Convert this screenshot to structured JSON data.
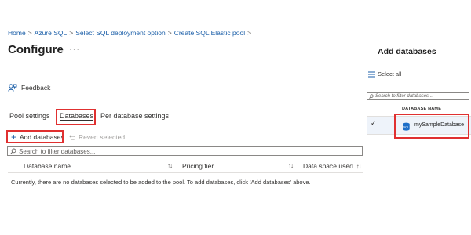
{
  "breadcrumb": {
    "items": [
      "Home",
      "Azure SQL",
      "Select SQL deployment option",
      "Create SQL Elastic pool"
    ],
    "separator": ">"
  },
  "page": {
    "title": "Configure",
    "more": "···"
  },
  "feedback": {
    "label": "Feedback",
    "icon": "feedback-icon"
  },
  "tabs": [
    {
      "label": "Pool settings",
      "active": false
    },
    {
      "label": "Databases",
      "active": true
    },
    {
      "label": "Per database settings",
      "active": false
    }
  ],
  "toolbar": {
    "add_label": "Add databases",
    "revert_label": "Revert selected"
  },
  "filter": {
    "placeholder": "Search to filter databases..."
  },
  "table": {
    "columns": [
      "Database name",
      "Pricing tier",
      "Data space used"
    ],
    "sort_glyph": "↑↓",
    "empty_message": "Currently, there are no databases selected to be added to the pool. To add databases, click 'Add databases' above."
  },
  "side_panel": {
    "title": "Add databases",
    "select_all": "Select all",
    "filter_placeholder": "Search to filter databases...",
    "column_header": "DATABASE NAME",
    "rows": [
      {
        "name": "mySampleDatabase",
        "checked": true
      }
    ]
  },
  "colors": {
    "accent": "#1a5ea8",
    "highlight_box": "#e03030",
    "selected_row": "#eef3fa"
  }
}
